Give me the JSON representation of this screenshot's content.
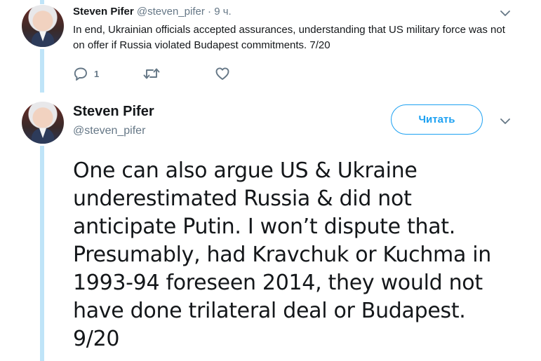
{
  "tweet1": {
    "author_name": "Steven Pifer",
    "author_handle": "@steven_pifer",
    "separator": " · ",
    "time": "9 ч.",
    "text": "In end, Ukrainian officials accepted assurances, understanding that US military force was not on offer if Russia violated Budapest commitments. 7/20",
    "reply_count": "1",
    "icons": [
      "reply-icon",
      "retweet-icon",
      "like-icon",
      "chevron-down-icon"
    ]
  },
  "tweet2": {
    "author_name": "Steven Pifer",
    "author_handle": "@steven_pifer",
    "follow_label": "Читать",
    "text": "One can also argue US & Ukraine\nunderestimated Russia & did not\nanticipate Putin. I won’t dispute that.\nPresumably, had Kravchuk or Kuchma in\n1993-94 foreseen 2014, they would not\nhave done trilateral deal or Budapest.\n9/20",
    "icons": [
      "chevron-down-icon"
    ]
  },
  "colors": {
    "accent": "#1da1f2",
    "thread_line": "#bfe4f8",
    "secondary_text": "#657786"
  }
}
